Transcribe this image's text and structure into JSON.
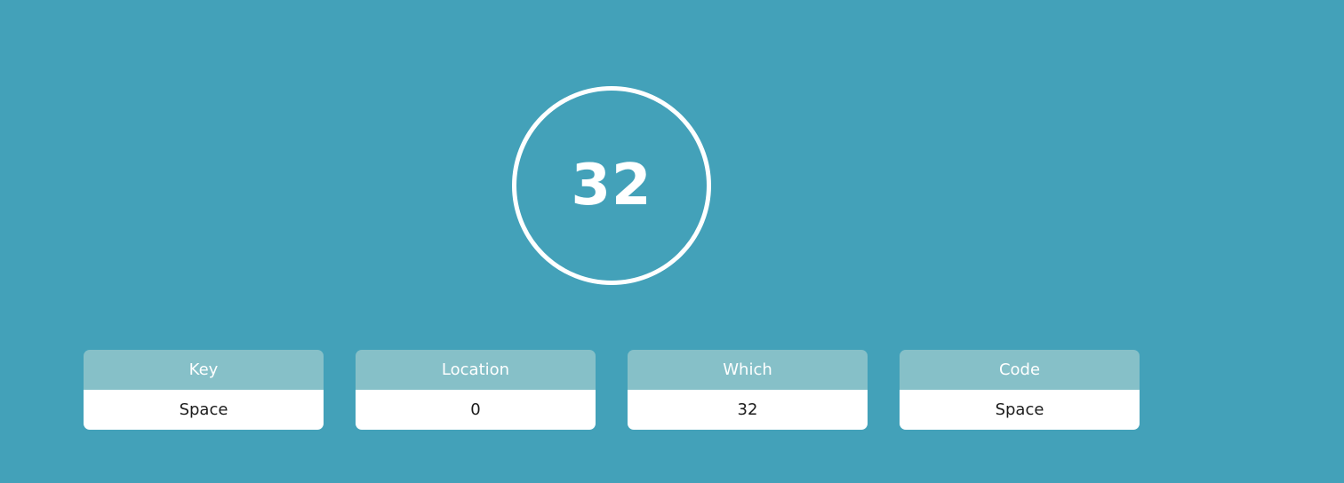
{
  "key_display": {
    "code": "32"
  },
  "info_cards": [
    {
      "label": "Key",
      "value": "Space"
    },
    {
      "label": "Location",
      "value": "0"
    },
    {
      "label": "Which",
      "value": "32"
    },
    {
      "label": "Code",
      "value": "Space"
    }
  ],
  "colors": {
    "background": "#43a1b9",
    "card_header": "#86c0c8",
    "card_body": "#ffffff",
    "circle": "#ffffff"
  }
}
